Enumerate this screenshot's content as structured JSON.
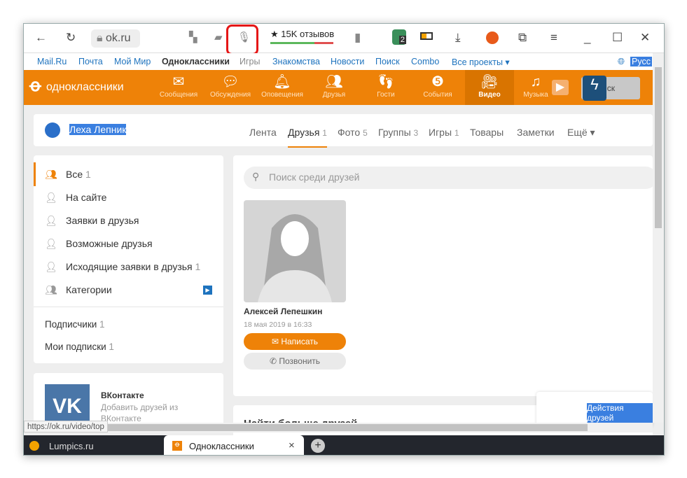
{
  "browser": {
    "address": "ok.ru",
    "reviews": "★ 15K отзывов",
    "badge": "2",
    "status_url": "https://ok.ru/video/top",
    "tabs": [
      {
        "label": "Lumpics.ru"
      },
      {
        "label": "Одноклассники",
        "close": "×"
      }
    ],
    "new_tab": "+"
  },
  "mailbar": {
    "items": [
      "Mail.Ru",
      "Почта",
      "Мой Мир",
      "Одноклассники",
      "Игры",
      "Знакомства",
      "Новости",
      "Поиск",
      "Combo",
      "Все проекты ▾"
    ],
    "lang": "Русс"
  },
  "ok": {
    "logo": "одноклассники",
    "items": [
      "Сообщения",
      "Обсуждения",
      "Оповещения",
      "Друзья",
      "Гости",
      "События",
      "Видео",
      "Музыка"
    ],
    "search": "иск"
  },
  "profile": {
    "name": "Леха Лепник",
    "nav": [
      {
        "label": "Лента",
        "count": ""
      },
      {
        "label": "Друзья",
        "count": "1"
      },
      {
        "label": "Фото",
        "count": "5"
      },
      {
        "label": "Группы",
        "count": "3"
      },
      {
        "label": "Игры",
        "count": "1"
      },
      {
        "label": "Товары",
        "count": ""
      },
      {
        "label": "Заметки",
        "count": ""
      },
      {
        "label": "Ещё ▾",
        "count": ""
      }
    ]
  },
  "menu": {
    "items": [
      {
        "label": "Все",
        "count": "1"
      },
      {
        "label": "На сайте",
        "count": ""
      },
      {
        "label": "Заявки в друзья",
        "count": ""
      },
      {
        "label": "Возможные друзья",
        "count": ""
      },
      {
        "label": "Исходящие заявки в друзья",
        "count": "1"
      },
      {
        "label": "Категории",
        "count": ""
      }
    ],
    "subs": [
      {
        "label": "Подписчики",
        "count": "1"
      },
      {
        "label": "Мои подписки",
        "count": "1"
      }
    ]
  },
  "vk": {
    "title": "ВКонтакте",
    "desc": "Добавить друзей из ВКонтакте"
  },
  "friends": {
    "search_placeholder": "Поиск среди друзей",
    "list": [
      {
        "name": "Алексей Лепешкин",
        "date": "18 мая 2019 в 16:33",
        "write": "Написать",
        "call": "Позвонить"
      }
    ]
  },
  "more": {
    "title": "Найти больше друзей"
  },
  "actions": {
    "label": "Действия друзей"
  }
}
